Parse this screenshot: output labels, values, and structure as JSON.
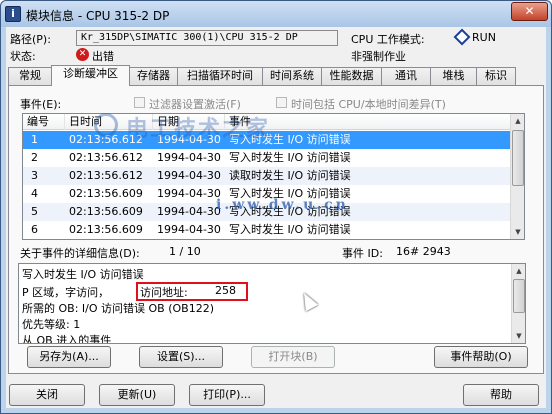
{
  "window": {
    "title": "模块信息 - CPU 315-2 DP",
    "close_label": "✕"
  },
  "header": {
    "path_label": "路径(P):",
    "path_value": "Kr_315DP\\SIMATIC 300(1)\\CPU 315-2 DP",
    "status_label": "状态:",
    "status_value": "出错",
    "mode_label": "CPU 工作模式:",
    "mode_value": "RUN",
    "force_value": "非强制作业"
  },
  "tabs": [
    {
      "label": "常规"
    },
    {
      "label": "诊断缓冲区"
    },
    {
      "label": "存储器"
    },
    {
      "label": "扫描循环时间"
    },
    {
      "label": "时间系统"
    },
    {
      "label": "性能数据"
    },
    {
      "label": "通讯"
    },
    {
      "label": "堆栈"
    },
    {
      "label": "标识"
    }
  ],
  "events": {
    "label": "事件(E):",
    "filter_label": "过滤器设置激活(F)",
    "tz_label": "时间包括 CPU/本地时间差异(T)",
    "columns": [
      "编号",
      "日时间",
      "日期",
      "事件"
    ],
    "rows": [
      {
        "no": "1",
        "time": "02:13:56.612",
        "date": "1994-04-30",
        "event": "写入时发生 I/O 访问错误"
      },
      {
        "no": "2",
        "time": "02:13:56.612",
        "date": "1994-04-30",
        "event": "写入时发生 I/O 访问错误"
      },
      {
        "no": "3",
        "time": "02:13:56.612",
        "date": "1994-04-30",
        "event": "读取时发生 I/O 访问错误"
      },
      {
        "no": "4",
        "time": "02:13:56.609",
        "date": "1994-04-30",
        "event": "写入时发生 I/O 访问错误"
      },
      {
        "no": "5",
        "time": "02:13:56.609",
        "date": "1994-04-30",
        "event": "写入时发生 I/O 访问错误"
      },
      {
        "no": "6",
        "time": "02:13:56.609",
        "date": "1994-04-30",
        "event": "写入时发生 I/O 访问错误"
      }
    ]
  },
  "watermark": {
    "text": "电工技术之家",
    "url": "i.ww.dw.u.cn"
  },
  "details": {
    "title": "关于事件的详细信息(D):",
    "counter": "1 / 10",
    "event_id_label": "事件 ID:",
    "event_id": "16# 2943",
    "line1": "写入时发生 I/O 访问错误",
    "line2_a": "P 区域，字访问，",
    "line2_b": "访问地址:",
    "line2_c": "258",
    "line3": "所需的 OB: I/O 访问错误 OB (OB122)",
    "line4": "优先等级:    1",
    "line5": "从 OB 进入的事件"
  },
  "buttons": {
    "save_as": "另存为(A)...",
    "settings": "设置(S)...",
    "open_block": "打开块(B)",
    "event_help": "事件帮助(O)",
    "close": "关闭",
    "refresh": "更新(U)",
    "print": "打印(P)...",
    "help": "帮助"
  }
}
